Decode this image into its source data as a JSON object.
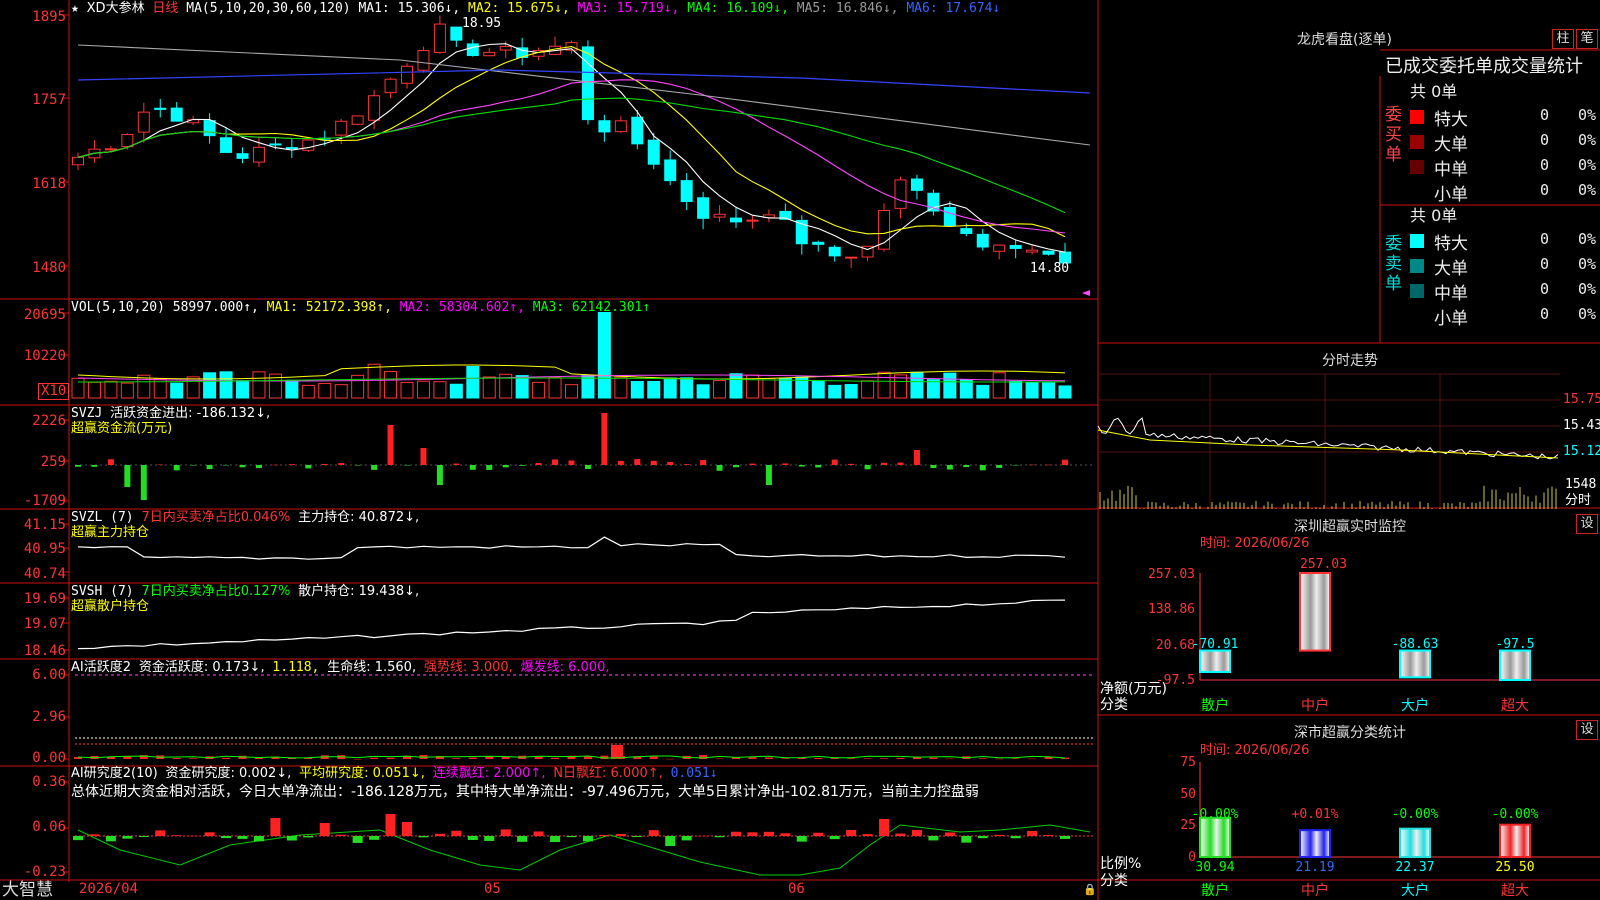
{
  "app": {
    "brand": "大智慧"
  },
  "main_chart": {
    "star": "★",
    "stock_name": "XD大参林",
    "period": "日线",
    "ma_label": "MA(5,10,20,30,60,120)",
    "ma1": "MA1: 15.306↓,",
    "ma2": "MA2: 15.675↓,",
    "ma3": "MA3: 15.719↓,",
    "ma4": "MA4: 16.109↓,",
    "ma5": "MA5: 16.846↓,",
    "ma6": "MA6: 17.674↓",
    "high_label": "18.95",
    "low_label": "14.80",
    "y_ticks": [
      "1895",
      "1757",
      "1618",
      "1480"
    ]
  },
  "vol_panel": {
    "label": "VOL(5,10,20)",
    "value": "58997.000↑,",
    "ma1": "MA1: 52172.398↑,",
    "ma2": "MA2: 58304.602↑,",
    "ma3": "MA3: 62142.301↑",
    "y_ticks": [
      "20695",
      "10220"
    ],
    "unit": "X10"
  },
  "svzj_panel": {
    "label": "SVZJ",
    "desc": "活跃资金进出: -186.132↓,",
    "subtitle": "超赢资金流(万元)",
    "y_ticks": [
      "2226",
      "259",
      "-1709"
    ]
  },
  "svzl_panel": {
    "label": "SVZL (7)",
    "ratio": "7日内买卖净占比0.046%",
    "hold": "主力持仓: 40.872↓,",
    "subtitle": "超赢主力持仓",
    "y_ticks": [
      "41.15",
      "40.95",
      "40.74"
    ]
  },
  "svsh_panel": {
    "label": "SVSH (7)",
    "ratio": "7日内买卖净占比0.127%",
    "hold": "散户持仓: 19.438↓,",
    "subtitle": "超赢散户持仓",
    "y_ticks": [
      "19.69",
      "19.07",
      "18.46"
    ]
  },
  "ai_active": {
    "label": "AI活跃度2",
    "d1": "资金活跃度: 0.173↓,",
    "d2": "1.118,",
    "d3": "生命线: 1.560,",
    "d4": "强势线: 3.000,",
    "d5": "爆发线: 6.000,",
    "y_ticks": [
      "6.00",
      "2.96",
      "0.00"
    ]
  },
  "ai_research": {
    "label": "AI研究度2(10)",
    "d1": "资金研究度: 0.002↓,",
    "d2": "平均研究度: 0.051↓,",
    "d3": "连续飘红: 2.000↑,",
    "d4": "N日飘红: 6.000↑,",
    "d5": "0.051↓",
    "summary": "总体近期大资金相对活跃，今日大单净流出：-186.128万元，其中特大单净流出：-97.496万元，大单5日累计净出-102.81万元，当前主力控盘弱",
    "y_ticks": [
      "0.36",
      "0.06",
      "-0.23"
    ]
  },
  "x_axis": {
    "labels": [
      "2026/04",
      "05",
      "06"
    ]
  },
  "longhu": {
    "title": "龙虎看盘(逐单)",
    "btn_bar": "柱",
    "btn_pen": "笔",
    "tabs": "已成交委托单成交量统计",
    "buy_side": "委买单",
    "sell_side": "委卖单",
    "buy_total": "共 0单",
    "sell_total": "共 0单",
    "buy_rows": [
      {
        "name": "特大",
        "value": "0",
        "pct": "0%",
        "color": "#ff0000"
      },
      {
        "name": "大单",
        "value": "0",
        "pct": "0%",
        "color": "#990000"
      },
      {
        "name": "中单",
        "value": "0",
        "pct": "0%",
        "color": "#660000"
      },
      {
        "name": "小单",
        "value": "0",
        "pct": "0%",
        "color": "#000000"
      }
    ],
    "sell_rows": [
      {
        "name": "特大",
        "value": "0",
        "pct": "0%",
        "color": "#00ffff"
      },
      {
        "name": "大单",
        "value": "0",
        "pct": "0%",
        "color": "#008888"
      },
      {
        "name": "中单",
        "value": "0",
        "pct": "0%",
        "color": "#006666"
      },
      {
        "name": "小单",
        "value": "0",
        "pct": "0%",
        "color": "#000000"
      }
    ]
  },
  "intraday": {
    "title": "分时走势",
    "prices": [
      "15.75",
      "15.43",
      "15.12"
    ],
    "vol": "1548",
    "unit": "分时"
  },
  "sz_monitor": {
    "title": "深圳超赢实时监控",
    "btn": "设",
    "time": "时间: 2026/06/26",
    "y_ticks": [
      "257.03",
      "138.86",
      "20.68",
      "-97.5"
    ],
    "ylabel": "净额(万元)",
    "xlabel": "分类",
    "top_value": "257.03"
  },
  "sz_class": {
    "title": "深市超赢分类统计",
    "btn": "设",
    "time": "时间: 2026/06/26",
    "y_ticks": [
      "75",
      "50",
      "25",
      "0"
    ],
    "ylabel": "比例%",
    "xlabel": "分类"
  },
  "chart_data": [
    {
      "type": "bar",
      "title": "深圳超赢实时监控",
      "ylabel": "净额(万元)",
      "xlabel": "分类",
      "categories": [
        "散户",
        "中户",
        "大户",
        "超大"
      ],
      "values": [
        -70.91,
        257.03,
        -88.63,
        -97.5
      ],
      "ylim": [
        -97.5,
        257.03
      ]
    },
    {
      "type": "bar",
      "title": "深市超赢分类统计",
      "ylabel": "比例%",
      "xlabel": "分类",
      "categories": [
        "散户",
        "中户",
        "大户",
        "超大"
      ],
      "values": [
        30.94,
        21.19,
        22.37,
        25.5
      ],
      "change": [
        "-0.00%",
        "+0.01%",
        "-0.00%",
        "-0.00%"
      ],
      "ylim": [
        0,
        75
      ]
    }
  ]
}
